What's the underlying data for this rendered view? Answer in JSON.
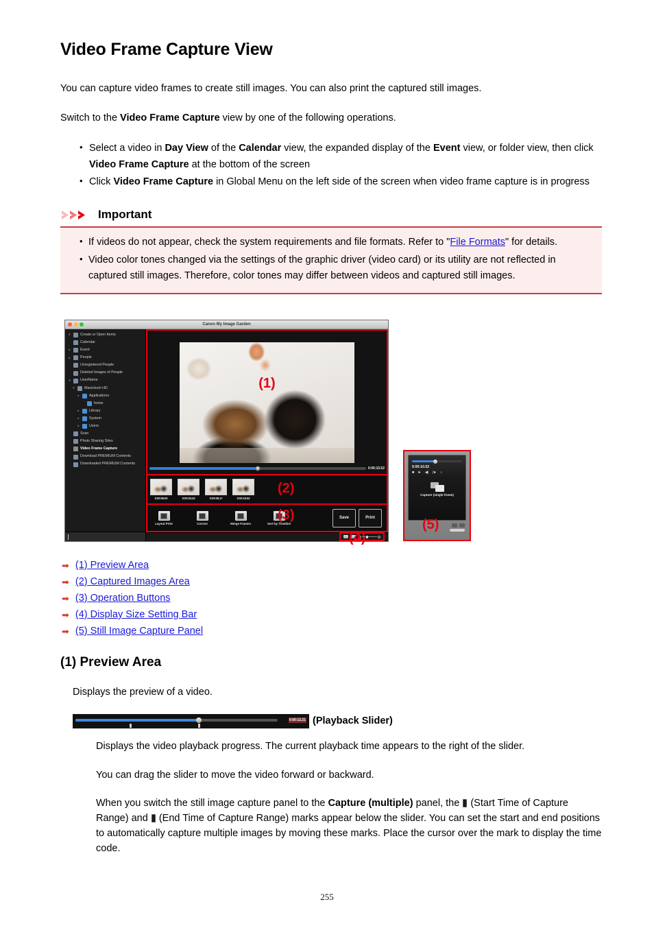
{
  "document": {
    "title": "Video Frame Capture View",
    "page_number": "255",
    "intro": "You can capture video frames to create still images. You can also print the captured still images.",
    "switch_intro_pre": "Switch to the ",
    "switch_intro_bold": "Video Frame Capture",
    "switch_intro_post": " view by one of the following operations.",
    "bullets": [
      {
        "parts": [
          {
            "t": "Select a video in ",
            "b": false
          },
          {
            "t": "Day View",
            "b": true
          },
          {
            "t": " of the ",
            "b": false
          },
          {
            "t": "Calendar",
            "b": true
          },
          {
            "t": " view, the expanded display of the ",
            "b": false
          },
          {
            "t": "Event",
            "b": true
          },
          {
            "t": " view, or folder view, then click ",
            "b": false
          },
          {
            "t": "Video Frame Capture",
            "b": true
          },
          {
            "t": " at the bottom of the screen",
            "b": false
          }
        ]
      },
      {
        "parts": [
          {
            "t": "Click ",
            "b": false
          },
          {
            "t": "Video Frame Capture",
            "b": true
          },
          {
            "t": " in Global Menu on the left side of the screen when video frame capture is in progress",
            "b": false
          }
        ]
      }
    ]
  },
  "important": {
    "heading": "Important",
    "accent_color": "#e60012",
    "background_color": "#fdeeee",
    "border_color": "#cf3a3a",
    "item1_pre": "If videos do not appear, check the system requirements and file formats. Refer to \"",
    "item1_link": "File Formats",
    "item1_post": "\" for details.",
    "item2": "Video color tones changed via the settings of the graphic driver (video card) or its utility are not reflected in captured still images. Therefore, color tones may differ between videos and captured still images."
  },
  "screenshot": {
    "window_title": "Canon My Image Garden",
    "sidebar": [
      {
        "label": "Create or Open Items",
        "twisty": "▾",
        "indent": 0,
        "selected": false,
        "icon": "create-open-icon"
      },
      {
        "label": "Calendar",
        "twisty": "",
        "indent": 0,
        "selected": false,
        "icon": "calendar-icon"
      },
      {
        "label": "Event",
        "twisty": "▸",
        "indent": 0,
        "selected": false,
        "icon": "event-icon"
      },
      {
        "label": "People",
        "twisty": "▸",
        "indent": 0,
        "selected": false,
        "icon": "people-icon"
      },
      {
        "label": "Unregistered People",
        "twisty": "",
        "indent": 0,
        "selected": false,
        "icon": "unregistered-people-icon"
      },
      {
        "label": "Deleted Images of People",
        "twisty": "",
        "indent": 0,
        "selected": false,
        "icon": "deleted-people-icon"
      },
      {
        "label": "UserName",
        "twisty": "▾",
        "indent": 0,
        "selected": false,
        "icon": "computer-icon"
      },
      {
        "label": "Macintosh HD",
        "twisty": "▾",
        "indent": 1,
        "selected": false,
        "icon": "harddisk-icon"
      },
      {
        "label": "Applications",
        "twisty": "▸",
        "indent": 2,
        "selected": false,
        "icon": "folder-icon"
      },
      {
        "label": "home",
        "twisty": "",
        "indent": 3,
        "selected": false,
        "icon": "folder-icon"
      },
      {
        "label": "Library",
        "twisty": "▸",
        "indent": 2,
        "selected": false,
        "icon": "folder-icon"
      },
      {
        "label": "System",
        "twisty": "▸",
        "indent": 2,
        "selected": false,
        "icon": "folder-icon"
      },
      {
        "label": "Users",
        "twisty": "▸",
        "indent": 2,
        "selected": false,
        "icon": "folder-icon"
      },
      {
        "label": "Scan",
        "twisty": "",
        "indent": 0,
        "selected": false,
        "icon": "scan-icon"
      },
      {
        "label": "Photo Sharing Sites",
        "twisty": "",
        "indent": 0,
        "selected": false,
        "icon": "photo-sharing-icon"
      },
      {
        "label": "Video Frame Capture",
        "twisty": "",
        "indent": 0,
        "selected": true,
        "icon": "video-frame-capture-icon"
      },
      {
        "label": "Download PREMIUM Contents",
        "twisty": "",
        "indent": 0,
        "selected": false,
        "icon": "download-premium-icon"
      },
      {
        "label": "Downloaded PREMIUM Contents",
        "twisty": "",
        "indent": 0,
        "selected": false,
        "icon": "downloaded-premium-icon"
      }
    ],
    "preview": {
      "callout": "(1)",
      "playback_time": "0:00:10.52"
    },
    "captured_images": {
      "callout": "(2)",
      "thumbnails": [
        {
          "time": "0:00:06.00"
        },
        {
          "time": "0:00:03.43"
        },
        {
          "time": "0:00:08.17"
        },
        {
          "time": "0:00:10.52"
        }
      ]
    },
    "operation_buttons": {
      "callout": "(3)",
      "buttons": [
        {
          "label": "Layout Print",
          "icon": "layout-print-icon"
        },
        {
          "label": "Correct",
          "icon": "correct-icon"
        },
        {
          "label": "Merge Frames",
          "icon": "merge-frames-icon"
        },
        {
          "label": "Sort by Timeline",
          "icon": "sort-by-timeline-icon"
        }
      ],
      "save_label": "Save",
      "print_label": "Print"
    },
    "display_size_bar": {
      "callout": "(4)"
    },
    "capture_panel": {
      "callout": "(5)",
      "time": "0:00:10.52",
      "capture_label": "Capture (single frame)",
      "controls": [
        "stop-icon",
        "play-icon",
        "step-back-icon",
        "step-forward-icon",
        "volume-icon"
      ]
    }
  },
  "links": [
    {
      "label": "(1) Preview Area"
    },
    {
      "label": "(2) Captured Images Area"
    },
    {
      "label": "(3) Operation Buttons"
    },
    {
      "label": "(4) Display Size Setting Bar"
    },
    {
      "label": "(5) Still Image Capture Panel"
    }
  ],
  "section1": {
    "title": "(1) Preview Area",
    "desc": "Displays the preview of a video.",
    "slider_time": "0:00:12.21",
    "slider_caption": "(Playback Slider)",
    "p1": "Displays the video playback progress. The current playback time appears to the right of the slider.",
    "p2": "You can drag the slider to move the video forward or backward.",
    "p3_a": "When you switch the still image capture panel to the ",
    "p3_bold": "Capture (multiple)",
    "p3_b": " panel, the ",
    "p3_c": " (Start Time of Capture Range) and ",
    "p3_d": " (End Time of Capture Range) marks appear below the slider. You can set the start and end positions to automatically capture multiple images by moving these marks. Place the cursor over the mark to display the time code."
  }
}
